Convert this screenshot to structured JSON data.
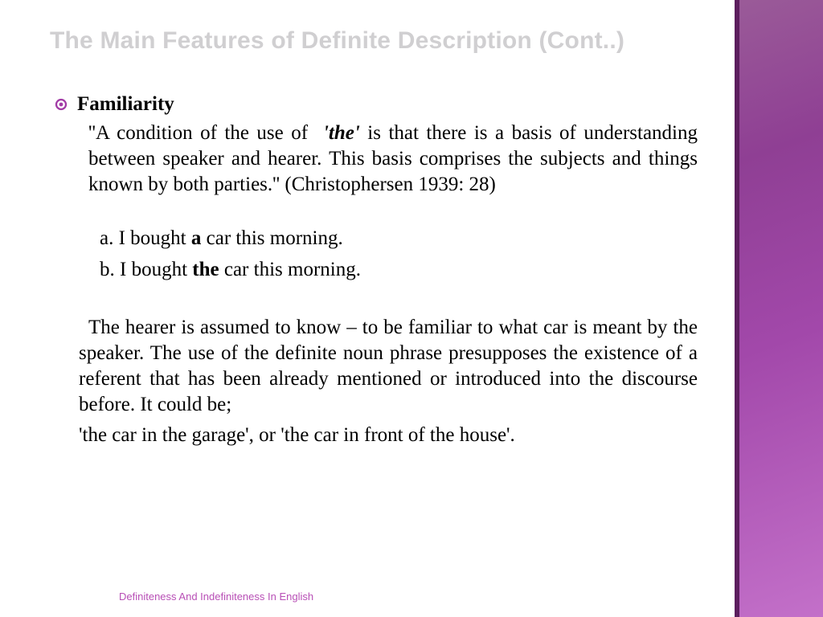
{
  "title": "The Main Features of Definite Description (Cont..)",
  "bullet_heading": "Familiarity",
  "quote": {
    "open": "''A condition of the use of ",
    "the_word": "'the'",
    "rest": " is that there is a basis of understanding between speaker and hearer. This basis comprises the subjects and things known by both parties.'' (Christophersen 1939: 28)"
  },
  "examples": {
    "a_pre": "a.  I bought ",
    "a_bold": "a",
    "a_post": " car this morning.",
    "b_pre": "b.  I bought ",
    "b_bold": "the",
    "b_post": " car this morning."
  },
  "para2": "The hearer is assumed to know – to be familiar to what car is meant by the speaker. The use of the definite noun phrase presupposes the existence of a referent that has been already mentioned or introduced into the discourse before. It could be;",
  "para3": "'the car in the garage',   or   'the car in front of the house'.",
  "footer": "Definiteness And Indefiniteness In English"
}
